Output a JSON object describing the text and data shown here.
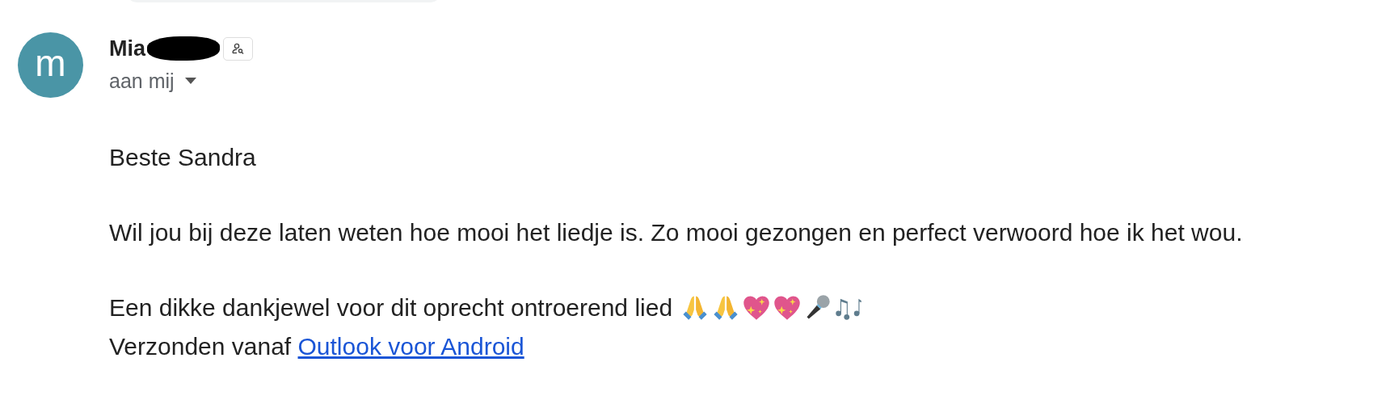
{
  "sender": {
    "avatar_letter": "m",
    "name": "Mia",
    "recipient": "aan mij"
  },
  "body": {
    "greeting": "Beste Sandra",
    "paragraph": "Wil jou bij deze laten weten hoe mooi het liedje is. Zo mooi gezongen en perfect verwoord hoe ik het wou.",
    "thanks": "Een dikke dankjewel voor dit oprecht ontroerend lied",
    "emojis": [
      {
        "kind": "hands"
      },
      {
        "kind": "hands"
      },
      {
        "kind": "heart"
      },
      {
        "kind": "heart"
      },
      {
        "kind": "mic"
      },
      {
        "kind": "notes"
      }
    ],
    "signature_prefix": "Verzonden vanaf",
    "signature_link": "Outlook voor Android"
  }
}
